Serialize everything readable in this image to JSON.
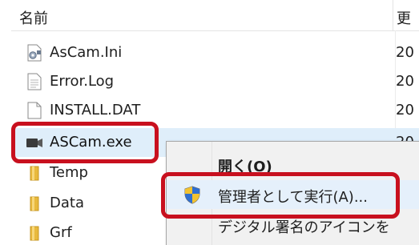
{
  "header": {
    "name_col": "名前",
    "date_col": "更"
  },
  "files": [
    {
      "name": "AsCam.Ini",
      "date": "20",
      "icon": "settings-file-icon"
    },
    {
      "name": "Error.Log",
      "date": "20",
      "icon": "text-file-icon"
    },
    {
      "name": "INSTALL.DAT",
      "date": "20",
      "icon": "blank-file-icon"
    },
    {
      "name": "ASCam.exe",
      "date": "20",
      "icon": "video-camera-app-icon"
    },
    {
      "name": "Temp",
      "date": "",
      "icon": "folder-icon"
    },
    {
      "name": "Data",
      "date": "",
      "icon": "folder-icon"
    },
    {
      "name": "Grf",
      "date": "",
      "icon": "folder-icon"
    }
  ],
  "context_menu": {
    "items": [
      {
        "label": "開く(O)",
        "icon": ""
      },
      {
        "label": "管理者として実行(A)...",
        "icon": "uac-shield-icon"
      },
      {
        "label": "デジタル署名のアイコンを",
        "icon": ""
      }
    ]
  },
  "colors": {
    "highlight": "#c8101e",
    "selection": "#dfeefa",
    "menu_bg": "#f1f1f1",
    "folder": "#e8b93c"
  }
}
